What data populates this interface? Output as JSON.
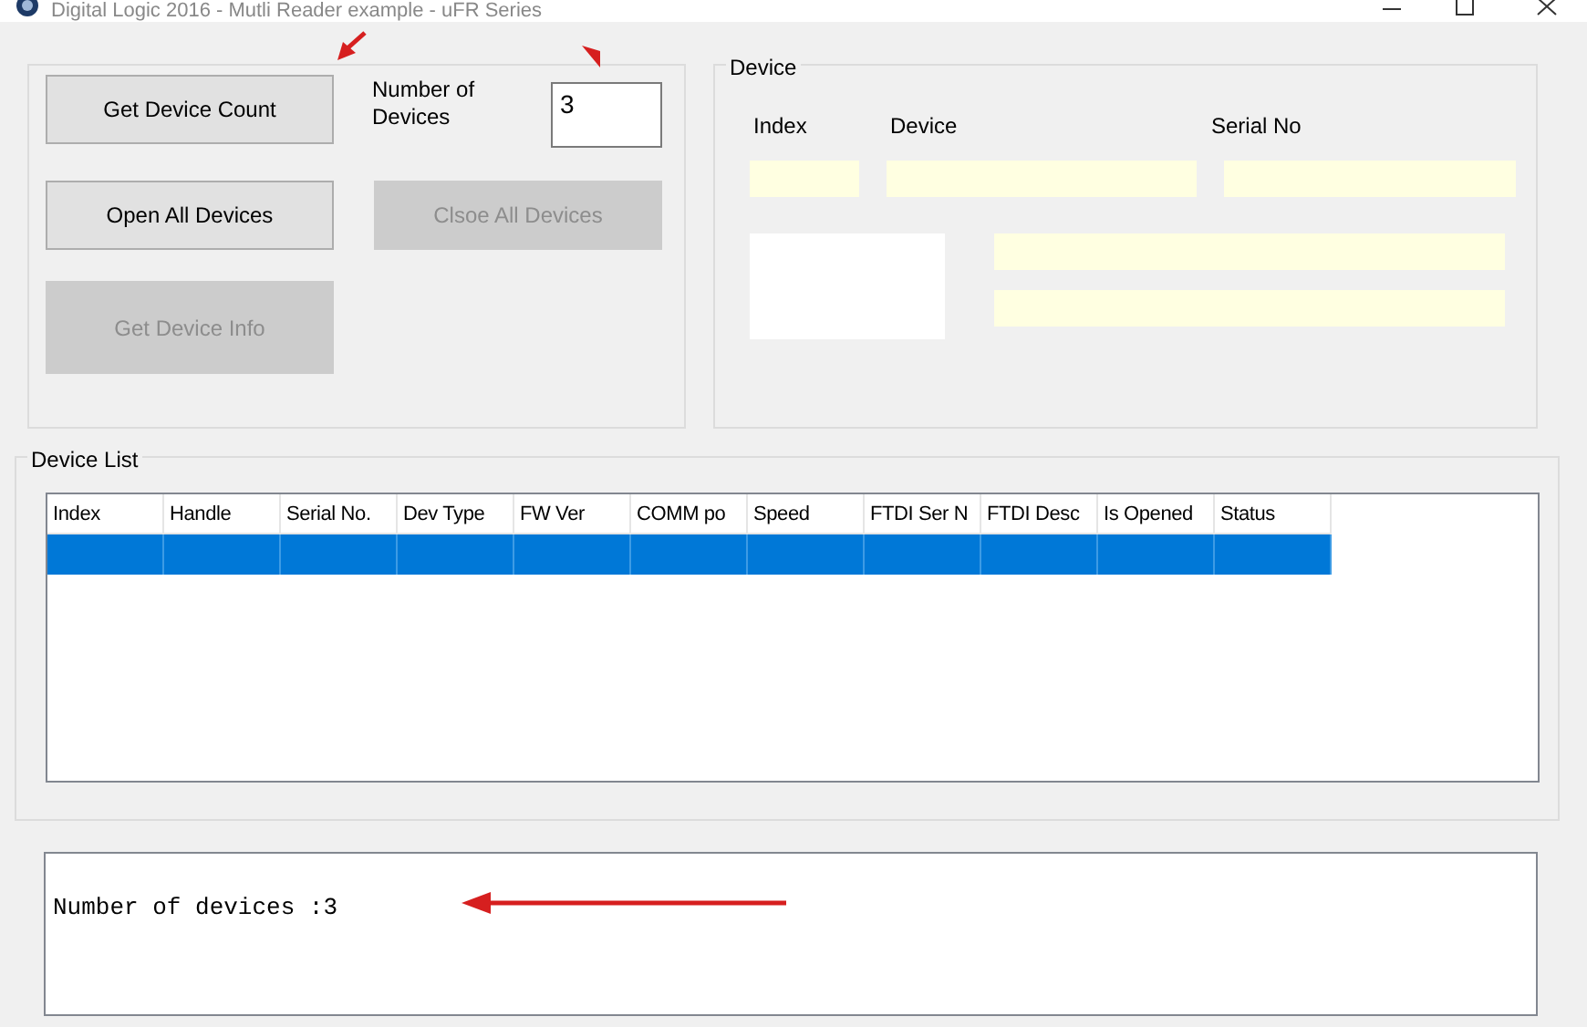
{
  "window": {
    "title": "Digital Logic 2016 - Mutli Reader example - uFR Series"
  },
  "controls_group": {
    "buttons": [
      {
        "label": "Get Device Count",
        "disabled": false
      },
      {
        "label": "Open All Devices",
        "disabled": false
      },
      {
        "label": "Clsoe All Devices",
        "disabled": true
      },
      {
        "label": "Get Device Info",
        "disabled": true
      }
    ],
    "count_label": "Number of Devices",
    "count_value": "3"
  },
  "device_group": {
    "title": "Device",
    "labels": [
      "Index",
      "Device",
      "Serial No"
    ]
  },
  "device_list": {
    "title": "Device List",
    "columns": [
      "Index",
      "Handle",
      "Serial No.",
      "Dev Type",
      "FW Ver",
      "COMM po",
      "Speed",
      "FTDI Ser N",
      "FTDI Desc",
      "Is Opened",
      "Status"
    ],
    "rows": [
      {
        "selected": true
      }
    ]
  },
  "log": {
    "text": "Number of devices :3"
  }
}
